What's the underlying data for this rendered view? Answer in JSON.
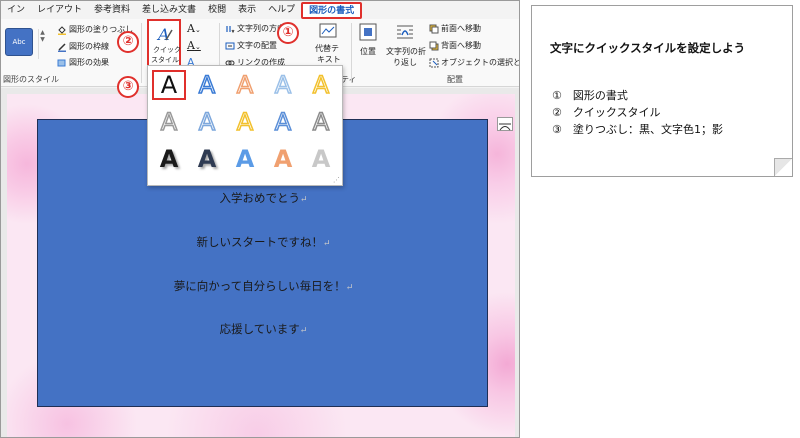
{
  "tabs": [
    "イン",
    "レイアウト",
    "参考資料",
    "差し込み文書",
    "校閲",
    "表示",
    "ヘルプ",
    "図形の書式"
  ],
  "active_tab": "図形の書式",
  "ribbon": {
    "style_thumb": "Abc",
    "fill_label": "図形の塗りつぶし",
    "outline_label": "図形の枠線",
    "effect_label": "図形の効果",
    "group_shape_styles": "図形のスタイル",
    "quick_style_label_1": "クイック",
    "quick_style_label_2": "スタイル",
    "group_wordart_partial": "ワ",
    "text_direction": "文字列の方向",
    "align_text": "文字の配置",
    "create_link": "リンクの作成",
    "text_group_partial": "ティ",
    "alt_text_1": "代替テ",
    "alt_text_2": "キスト",
    "position": "位置",
    "wrap_text_1": "文字列の折",
    "wrap_text_2": "り返し",
    "bring_forward": "前面へ移動",
    "send_backward": "背面へ移動",
    "selection_pane": "オブジェクトの選択と表示",
    "group_arrange": "配置"
  },
  "gallery": {
    "rows": [
      [
        {
          "glyph": "A",
          "color": "#111111"
        },
        {
          "glyph": "A",
          "color": "#3a7bd5"
        },
        {
          "glyph": "A",
          "color": "#f0a070"
        },
        {
          "glyph": "A",
          "color": "#9bc0e8"
        },
        {
          "glyph": "A",
          "color": "#f2c12e"
        }
      ],
      [
        {
          "glyph": "A",
          "color": "#9a9a9a"
        },
        {
          "glyph": "A",
          "color": "#7da7dc"
        },
        {
          "glyph": "A",
          "color": "#f2c12e"
        },
        {
          "glyph": "A",
          "color": "#5b8fd8"
        },
        {
          "glyph": "A",
          "color": "#8c8c8c"
        }
      ],
      [
        {
          "glyph": "A",
          "color": "#1a1a1a"
        },
        {
          "glyph": "A",
          "color": "#2f3b52"
        },
        {
          "glyph": "A",
          "color": "#5b9be6"
        },
        {
          "glyph": "A",
          "color": "#f0a070"
        },
        {
          "glyph": "A",
          "color": "#c8c8c8"
        }
      ]
    ]
  },
  "document": {
    "lines": [
      "入学おめでとう",
      "新しいスタートですね！",
      "夢に向かって自分らしい毎日を！",
      "応援しています"
    ],
    "paragraph_mark": "↵"
  },
  "callouts": [
    "①",
    "②",
    "③"
  ],
  "note": {
    "title": "文字にクイックスタイルを設定しよう",
    "items": [
      "①　図形の書式",
      "②　クイックスタイル",
      "③　塗りつぶし：黒、文字色1；影"
    ]
  }
}
